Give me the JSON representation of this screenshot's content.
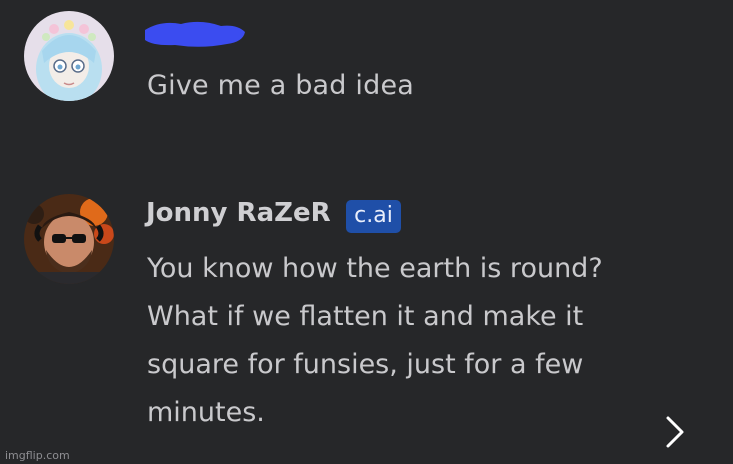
{
  "messages": [
    {
      "username": "",
      "text": "Give me a bad idea",
      "avatar_icon": "anime-girl-avatar-icon"
    },
    {
      "username": "Jonny RaZeR",
      "badge": "c.ai",
      "text_lines": [
        "You know how the earth is round?",
        "What if we flatten it and make it",
        "square for funsies, just for a few",
        "minutes."
      ],
      "avatar_icon": "bearded-man-avatar-icon"
    }
  ],
  "controls": {
    "next_icon": "chevron-right-icon"
  },
  "watermark": "imgflip.com",
  "colors": {
    "background": "#262729",
    "text": "#c9c9cc",
    "badge": "#1f4fa8",
    "redaction": "#3b4cf0"
  }
}
